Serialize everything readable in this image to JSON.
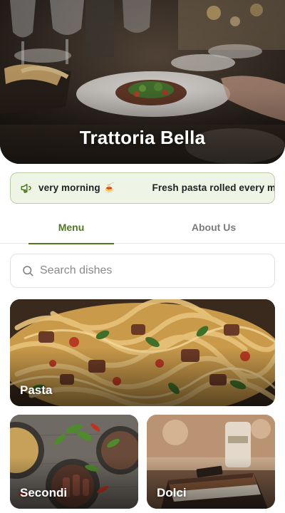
{
  "restaurant": {
    "name": "Trattoria Bella"
  },
  "announcement": {
    "icon": "megaphone-icon",
    "text_tail": "very morning 🍝",
    "text_head": "Fresh pasta rolled every m"
  },
  "tabs": [
    {
      "label": "Menu",
      "active": true
    },
    {
      "label": "About Us",
      "active": false
    }
  ],
  "search": {
    "icon": "search-icon",
    "placeholder": "Search dishes",
    "value": ""
  },
  "categories": [
    {
      "label": "Pasta"
    },
    {
      "label": "Secondi"
    },
    {
      "label": "Dolci"
    }
  ],
  "colors": {
    "accent": "#4e7a1f",
    "announce_bg": "#eef4e6",
    "announce_border": "#b9cfa3",
    "tab_inactive": "#7b7b7b"
  }
}
